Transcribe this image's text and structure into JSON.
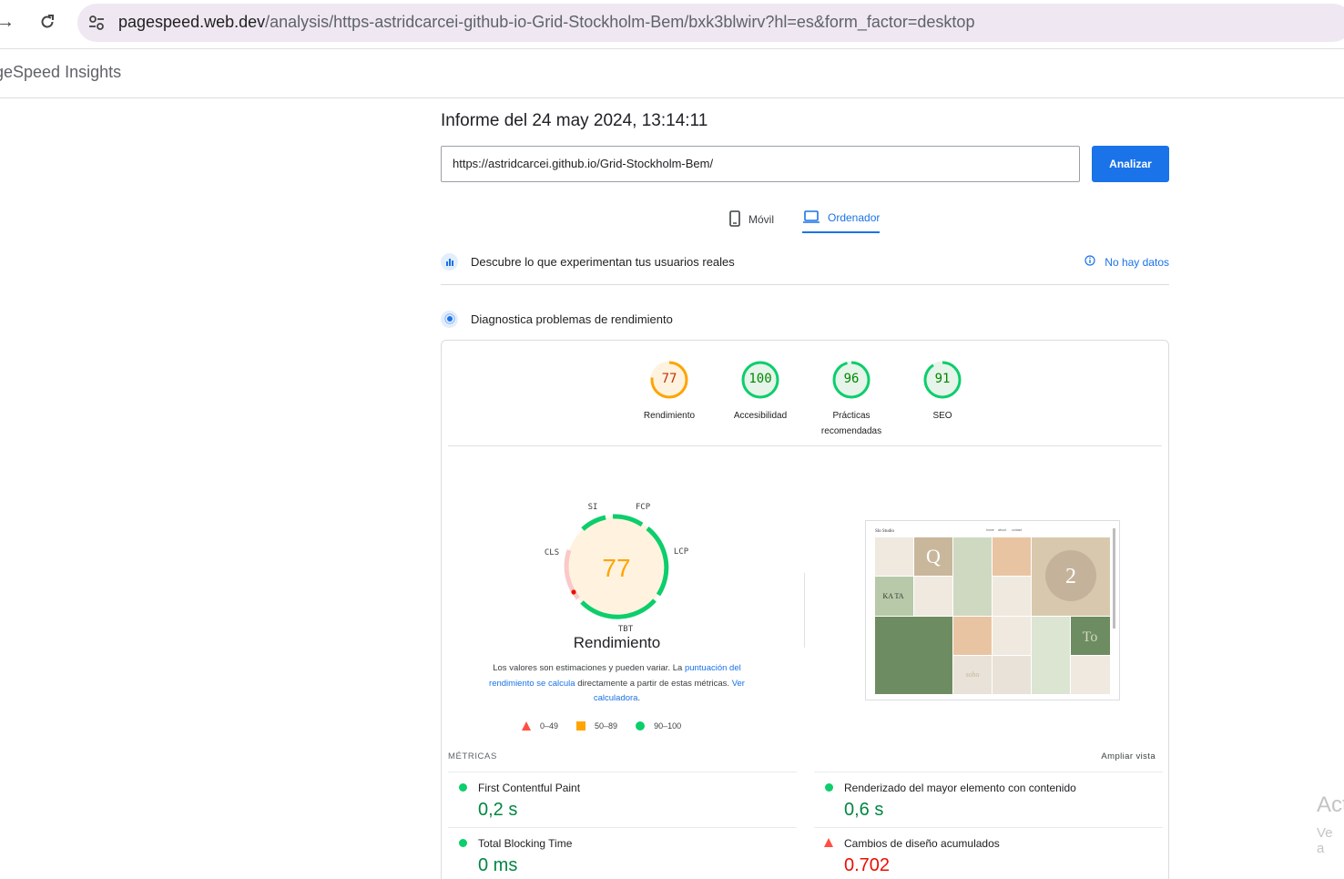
{
  "browser": {
    "url_host": "pagespeed.web.dev",
    "url_path": "/analysis/https-astridcarcei-github-io-Grid-Stockholm-Bem/bxk3blwirv?hl=es&form_factor=desktop"
  },
  "app": {
    "title": "geSpeed Insights"
  },
  "report": {
    "title": "Informe del 24 may 2024, 13:14:11",
    "url_value": "https://astridcarcei.github.io/Grid-Stockholm-Bem/",
    "analyze_label": "Analizar"
  },
  "tabs": {
    "mobile": "Móvil",
    "desktop": "Ordenador"
  },
  "sections": {
    "real_users": "Descubre lo que experimentan tus usuarios reales",
    "no_data": "No hay datos",
    "diagnose": "Diagnostica problemas de rendimiento"
  },
  "scores": [
    {
      "value": "77",
      "label": "Rendimiento",
      "label2": "",
      "fraction": 0.77,
      "color": "#ffa400",
      "bg": "#fff3e0",
      "text": "#c33300"
    },
    {
      "value": "100",
      "label": "Accesibilidad",
      "label2": "",
      "fraction": 1.0,
      "color": "#0cce6b",
      "bg": "#e6f4ea",
      "text": "#008800"
    },
    {
      "value": "96",
      "label": "Prácticas",
      "label2": "recomendadas",
      "fraction": 0.96,
      "color": "#0cce6b",
      "bg": "#e6f4ea",
      "text": "#008800"
    },
    {
      "value": "91",
      "label": "SEO",
      "label2": "",
      "fraction": 0.91,
      "color": "#0cce6b",
      "bg": "#e6f4ea",
      "text": "#008800"
    }
  ],
  "performance": {
    "score": "77",
    "label": "Rendimiento",
    "segments": {
      "si": "SI",
      "fcp": "FCP",
      "lcp": "LCP",
      "tbt": "TBT",
      "cls": "CLS"
    },
    "desc_1": "Los valores son estimaciones y pueden variar. La ",
    "desc_link1": "puntuación del rendimiento se calcula",
    "desc_2": " directamente a partir de estas métricas. ",
    "desc_link2": "Ver calculadora",
    "desc_3": "."
  },
  "legend": {
    "bad": "0–49",
    "avg": "50–89",
    "good": "90–100"
  },
  "metrics": {
    "heading": "MÉTRICAS",
    "expand": "Ampliar vista",
    "items": [
      {
        "label": "First Contentful Paint",
        "value": "0,2 s",
        "status": "good"
      },
      {
        "label": "Renderizado del mayor elemento con contenido",
        "value": "0,6 s",
        "status": "good"
      },
      {
        "label": "Total Blocking Time",
        "value": "0 ms",
        "status": "good"
      },
      {
        "label": "Cambios de diseño acumulados",
        "value": "0.702",
        "status": "bad"
      }
    ]
  },
  "thumb": {
    "site_name": "Slo Studio",
    "nav": [
      "home",
      "about",
      "contact"
    ],
    "tiles": [
      "Q",
      "2",
      "KA TA",
      "To",
      "soho"
    ]
  },
  "watermark": {
    "line1": "Act",
    "line2": "Ve a"
  }
}
